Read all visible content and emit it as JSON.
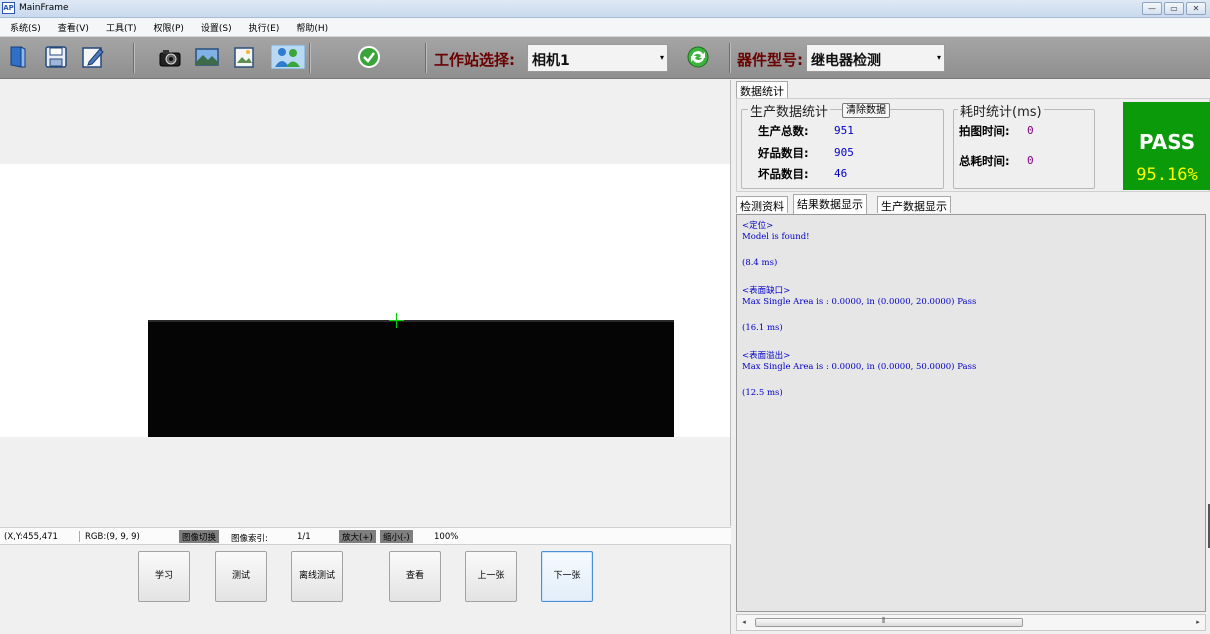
{
  "window": {
    "icon_text": "AP",
    "title": "MainFrame",
    "controls": [
      "—",
      "▭",
      "✕"
    ]
  },
  "menu": [
    "系统(S)",
    "查看(V)",
    "工具(T)",
    "权限(P)",
    "设置(S)",
    "执行(E)",
    "帮助(H)"
  ],
  "toolbar": {
    "icons": [
      "open-file-icon",
      "save-icon",
      "edit-icon",
      "camera-icon",
      "image-icon",
      "image-export-icon",
      "users-icon",
      "confirm-check-icon",
      "refresh-icon"
    ],
    "station_label": "工作站选择:",
    "station_value": "相机1",
    "device_label": "器件型号:",
    "device_value": "继电器检测",
    "dropdown_glyph": "▾"
  },
  "status": {
    "coords": "(X,Y:455,471",
    "rgb": "RGB:(9, 9, 9)",
    "image_switch": "图像切换",
    "image_index_label": "图像索引:",
    "image_index": "1/1",
    "zoom_in": "放大(+)",
    "zoom_out": "缩小(-)",
    "zoom_level": "100%"
  },
  "buttons": [
    "学习",
    "测试",
    "离线测试",
    "查看",
    "上一张",
    "下一张"
  ],
  "stats": {
    "tab": "数据统计",
    "production_title": "生产数据统计",
    "clear_button": "清除数据",
    "total_label": "生产总数:",
    "total": "951",
    "good_label": "好品数目:",
    "good": "905",
    "bad_label": "坏品数目:",
    "bad": "46",
    "time_title": "耗时统计(ms)",
    "capture_label": "拍图时间:",
    "capture": "0",
    "total_time_label": "总耗时间:",
    "total_time": "0",
    "result": "PASS",
    "yield": "95.16%",
    "colors": {
      "pass_bg": "#0a9a0a",
      "yield_text": "#ffff00",
      "value_blue": "#0000c8",
      "value_purple": "#800080"
    }
  },
  "result_tabs": [
    "检测资料",
    "结果数据显示",
    "生产数据显示"
  ],
  "results": [
    "<定位>",
    "Model is found!",
    "(8.4 ms)",
    "<表面缺口>",
    "Max Single Area is : 0.0000, in (0.0000, 20.0000) Pass",
    "(16.1 ms)",
    "<表面溢出>",
    "Max Single Area is : 0.0000, in (0.0000, 50.0000) Pass",
    "(12.5 ms)"
  ],
  "scroll": {
    "left": "◂",
    "right": "▸",
    "grip": "⦀"
  }
}
